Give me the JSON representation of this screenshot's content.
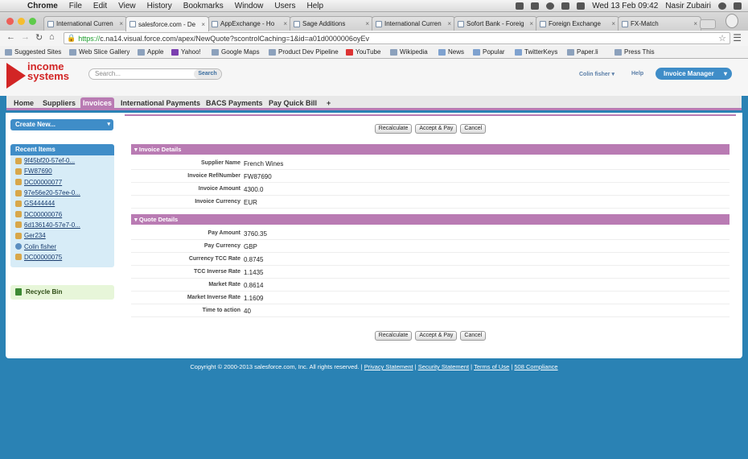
{
  "os_menubar": {
    "app": "Chrome",
    "menus": [
      "File",
      "Edit",
      "View",
      "History",
      "Bookmarks",
      "Window",
      "Users",
      "Help"
    ],
    "clock": "Wed 13 Feb  09:42",
    "user": "Nasir Zubairi"
  },
  "browser": {
    "tabs": [
      {
        "title": "International Curren"
      },
      {
        "title": "salesforce.com - De"
      },
      {
        "title": "AppExchange - Ho"
      },
      {
        "title": "Sage Additions"
      },
      {
        "title": "International Curren"
      },
      {
        "title": "Sofort Bank - Foreig"
      },
      {
        "title": "Foreign Exchange"
      },
      {
        "title": "FX-Match"
      }
    ],
    "url_scheme": "https://",
    "url_rest": "c.na14.visual.force.com/apex/NewQuote?scontrolCaching=1&id=a01d0000006oyEv",
    "bookmarks": [
      "Suggested Sites",
      "Web Slice Gallery",
      "Apple",
      "Yahoo!",
      "Google Maps",
      "Product Dev Pipeline",
      "YouTube",
      "Wikipedia",
      "News",
      "Popular",
      "TwitterKeys",
      "Paper.li",
      "Press This"
    ]
  },
  "header": {
    "logo_line1": "income",
    "logo_line2": "systems",
    "search_placeholder": "Search...",
    "search_button": "Search",
    "user_menu": "Colin fisher",
    "help": "Help",
    "app_menu": "Invoice Manager"
  },
  "nav": {
    "tabs": [
      "Home",
      "Suppliers",
      "Invoices",
      "International Payments",
      "BACS Payments",
      "Pay Quick Bill",
      "+"
    ],
    "active": "Invoices"
  },
  "sidebar": {
    "create_new": "Create New...",
    "recent_title": "Recent Items",
    "recent_items": [
      {
        "label": "9f45bf20-57ef-0...",
        "icon": "record-icon"
      },
      {
        "label": "FW87690",
        "icon": "record-icon"
      },
      {
        "label": "DC00000077",
        "icon": "record-icon"
      },
      {
        "label": "97e56e20-57ee-0...",
        "icon": "record-icon"
      },
      {
        "label": "GS444444",
        "icon": "record-icon"
      },
      {
        "label": "DC00000076",
        "icon": "record-icon"
      },
      {
        "label": "6d136140-57e7-0...",
        "icon": "record-icon"
      },
      {
        "label": "Ger234",
        "icon": "record-icon"
      },
      {
        "label": "Colin fisher",
        "icon": "person-icon"
      },
      {
        "label": "DC00000075",
        "icon": "record-icon"
      }
    ],
    "recycle_bin": "Recycle Bin"
  },
  "buttons": {
    "recalculate": "Recalculate",
    "accept_pay": "Accept & Pay",
    "cancel": "Cancel"
  },
  "invoice_details": {
    "title": "Invoice Details",
    "fields": [
      {
        "label": "Supplier Name",
        "value": "French Wines"
      },
      {
        "label": "Invoice Ref/Number",
        "value": "FW87690"
      },
      {
        "label": "Invoice Amount",
        "value": "4300.0"
      },
      {
        "label": "Invoice Currency",
        "value": "EUR"
      }
    ]
  },
  "quote_details": {
    "title": "Quote Details",
    "fields": [
      {
        "label": "Pay Amount",
        "value": "3760.35"
      },
      {
        "label": "Pay Currency",
        "value": "GBP"
      },
      {
        "label": "Currency TCC Rate",
        "value": "0.8745"
      },
      {
        "label": "TCC Inverse Rate",
        "value": "1.1435"
      },
      {
        "label": "Market Rate",
        "value": "0.8614"
      },
      {
        "label": "Market Inverse Rate",
        "value": "1.1609"
      },
      {
        "label": "Time to action",
        "value": "40"
      }
    ]
  },
  "footer": {
    "copyright": "Copyright © 2000-2013 salesforce.com, Inc. All rights reserved. |",
    "links": [
      "Privacy Statement",
      "Security Statement",
      "Terms of Use",
      "508 Compliance"
    ]
  }
}
